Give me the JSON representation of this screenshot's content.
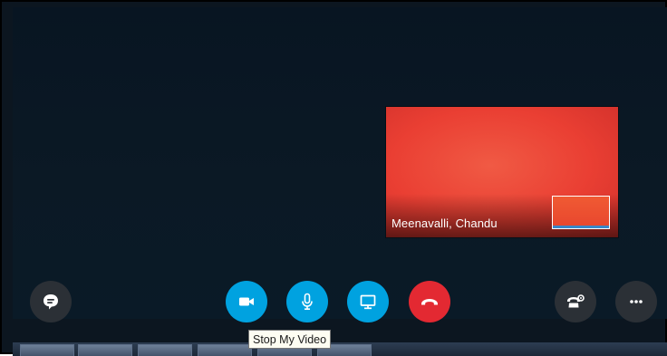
{
  "call": {
    "participant_name": "Meenavalli, Chandu"
  },
  "controls": {
    "chat": {
      "icon": "chat-bubble-icon",
      "color": "#2b3036"
    },
    "video": {
      "icon": "video-camera-icon",
      "color": "#00a2e0",
      "tooltip": "Stop My Video"
    },
    "mic": {
      "icon": "microphone-icon",
      "color": "#00a2e0"
    },
    "share": {
      "icon": "screen-share-icon",
      "color": "#00a2e0"
    },
    "end_call": {
      "icon": "hang-up-icon",
      "color": "#e32932"
    },
    "dialpad": {
      "icon": "phone-settings-icon",
      "color": "#2b3036"
    },
    "more": {
      "icon": "more-options-icon",
      "color": "#2b3036"
    }
  },
  "taskbar": {
    "items": [
      {
        "icon": "map-app-icon"
      },
      {
        "icon": "skype-app-icon"
      },
      {
        "icon": "excel-app-icon"
      },
      {
        "icon": "document-app-icon"
      },
      {
        "icon": "chrome-app-icon"
      },
      {
        "icon": "word-app-icon"
      }
    ]
  }
}
